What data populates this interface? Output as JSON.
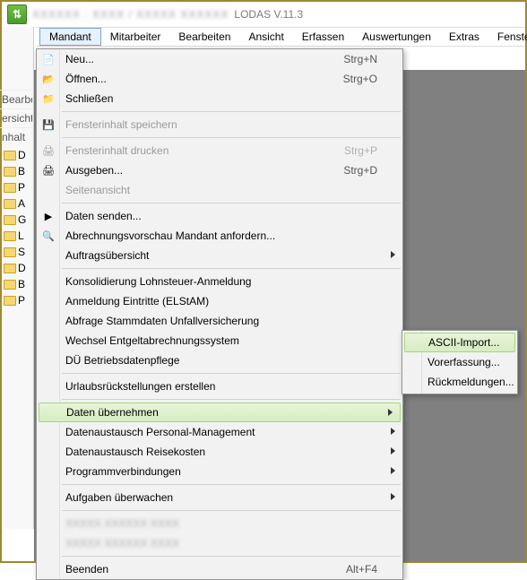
{
  "window": {
    "app_blur": "XXXXXX : XXXX / XXXXX XXXXXX",
    "title": "LODAS V.11.3"
  },
  "menubar": {
    "items": [
      "Mandant",
      "Mitarbeiter",
      "Bearbeiten",
      "Ansicht",
      "Erfassen",
      "Auswertungen",
      "Extras",
      "Fenster",
      "?"
    ],
    "active": 0
  },
  "side": {
    "bearbe": "Bearbe",
    "ersicht": "ersicht:",
    "nhalt": "nhalt"
  },
  "tree": {
    "rows": [
      {
        "t": "D"
      },
      {
        "t": "B"
      },
      {
        "t": "P"
      },
      {
        "t": "A"
      },
      {
        "t": "G"
      },
      {
        "t": "L"
      },
      {
        "t": "S"
      },
      {
        "t": "D"
      },
      {
        "t": "B"
      },
      {
        "t": "P"
      }
    ]
  },
  "toolbar_icons": [
    "page-icon",
    "copy-icon",
    "paste-icon",
    "wand-icon",
    "tree-icon",
    "page-add-icon",
    "doc-icon",
    "arrow-left-icon",
    "arrow-right-icon"
  ],
  "dropdown": {
    "items": [
      {
        "icon": "new",
        "label": "Neu...",
        "shortcut": "Strg+N"
      },
      {
        "icon": "open",
        "label": "Öffnen...",
        "shortcut": "Strg+O"
      },
      {
        "icon": "close",
        "label": "Schließen"
      },
      {
        "sep": true
      },
      {
        "icon": "save",
        "label": "Fensterinhalt speichern",
        "disabled": true
      },
      {
        "sep": true
      },
      {
        "icon": "print",
        "label": "Fensterinhalt drucken",
        "shortcut": "Strg+P",
        "disabled": true
      },
      {
        "icon": "output",
        "label": "Ausgeben...",
        "shortcut": "Strg+D"
      },
      {
        "label": "Seitenansicht",
        "disabled": true
      },
      {
        "sep": true
      },
      {
        "icon": "send",
        "label": "Daten senden..."
      },
      {
        "icon": "preview",
        "label": "Abrechnungsvorschau Mandant anfordern..."
      },
      {
        "label": "Auftragsübersicht",
        "submenu": true
      },
      {
        "sep": true
      },
      {
        "label": "Konsolidierung Lohnsteuer-Anmeldung"
      },
      {
        "label": "Anmeldung Eintritte (ELStAM)"
      },
      {
        "label": "Abfrage Stammdaten Unfallversicherung"
      },
      {
        "label": "Wechsel Entgeltabrechnungssystem"
      },
      {
        "label": "DÜ Betriebsdatenpflege"
      },
      {
        "sep": true
      },
      {
        "label": "Urlaubsrückstellungen erstellen"
      },
      {
        "sep": true
      },
      {
        "label": "Daten übernehmen",
        "submenu": true,
        "highlight": true
      },
      {
        "label": "Datenaustausch Personal-Management",
        "submenu": true
      },
      {
        "label": "Datenaustausch Reisekosten",
        "submenu": true
      },
      {
        "label": "Programmverbindungen",
        "submenu": true
      },
      {
        "sep": true
      },
      {
        "label": "Aufgaben überwachen",
        "submenu": true
      },
      {
        "sep": true
      },
      {
        "label": "",
        "blur": true
      },
      {
        "label": "",
        "blur": true
      },
      {
        "sep": true
      },
      {
        "label": "Beenden",
        "shortcut": "Alt+F4"
      }
    ]
  },
  "submenu": {
    "items": [
      {
        "label": "ASCII-Import...",
        "highlight": true
      },
      {
        "label": "Vorerfassung..."
      },
      {
        "label": "Rückmeldungen..."
      }
    ]
  }
}
